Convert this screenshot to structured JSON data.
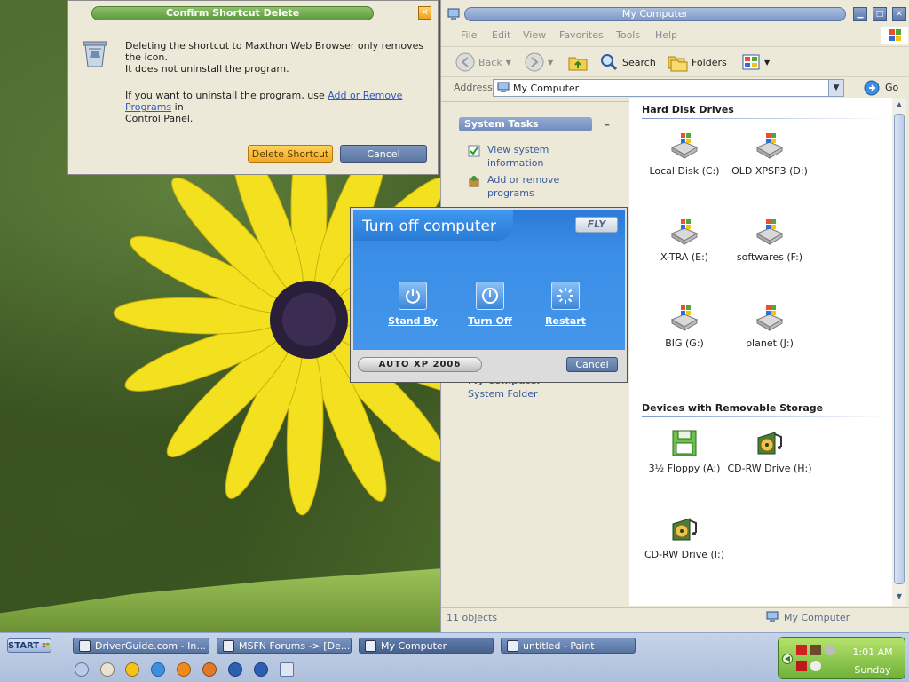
{
  "desktop": {},
  "confirm_dialog": {
    "title": "Confirm Shortcut Delete",
    "close_symbol": "✕",
    "message_line1": "Deleting the shortcut to Maxthon Web Browser only removes the icon.",
    "message_line2": "It does not uninstall the program.",
    "message2_prefix": "If you want to uninstall the program, use ",
    "message2_link": "Add or Remove Programs",
    "message2_suffix": " in",
    "message2_line2": "Control Panel.",
    "delete_button": "Delete Shortcut",
    "cancel_button": "Cancel"
  },
  "explorer": {
    "title": "My Computer",
    "window_buttons": {
      "minimize": "▁",
      "maximize": "□",
      "close": "✕"
    },
    "menu": [
      "File",
      "Edit",
      "View",
      "Favorites",
      "Tools",
      "Help"
    ],
    "toolbar": {
      "back": "Back",
      "search": "Search",
      "folders": "Folders"
    },
    "address": {
      "label": "Address",
      "value": "My Computer",
      "go": "Go"
    },
    "system_tasks": {
      "header": "System Tasks",
      "collapse": "–",
      "items": [
        {
          "line1": "View system",
          "line2": "information"
        },
        {
          "line1": "Add or remove",
          "line2": "programs"
        }
      ]
    },
    "details": {
      "name": "My Computer",
      "type": "System Folder"
    },
    "groups": {
      "hard_disks": {
        "header": "Hard Disk Drives",
        "drives": [
          "Local Disk (C:)",
          "OLD XPSP3 (D:)",
          "X-TRA (E:)",
          "softwares (F:)",
          "BIG (G:)",
          "planet (J:)"
        ]
      },
      "removable": {
        "header": "Devices with Removable Storage",
        "drives": [
          "3½ Floppy (A:)",
          "CD-RW Drive (H:)",
          "CD-RW Drive (I:)"
        ]
      }
    },
    "status": {
      "count": "11 objects",
      "location": "My Computer"
    },
    "colors": {
      "accent": "#7f99c6",
      "link": "#3a5b9c"
    }
  },
  "turn_off": {
    "title": "Turn off computer",
    "logo": "FLY",
    "options": [
      {
        "label": "Stand By",
        "icon": "standby-icon"
      },
      {
        "label": "Turn Off",
        "icon": "power-icon"
      },
      {
        "label": "Restart",
        "icon": "restart-icon"
      }
    ],
    "brand": "AUTO XP 2006",
    "cancel": "Cancel",
    "colors": {
      "panel": "#3a8ee6"
    }
  },
  "taskbar": {
    "start": "START",
    "tasks": [
      "DriverGuide.com - In...",
      "MSFN Forums -> [De...",
      "My Computer",
      "untitled - Paint"
    ],
    "clock": {
      "time": "1:01 AM",
      "day": "Sunday"
    }
  }
}
